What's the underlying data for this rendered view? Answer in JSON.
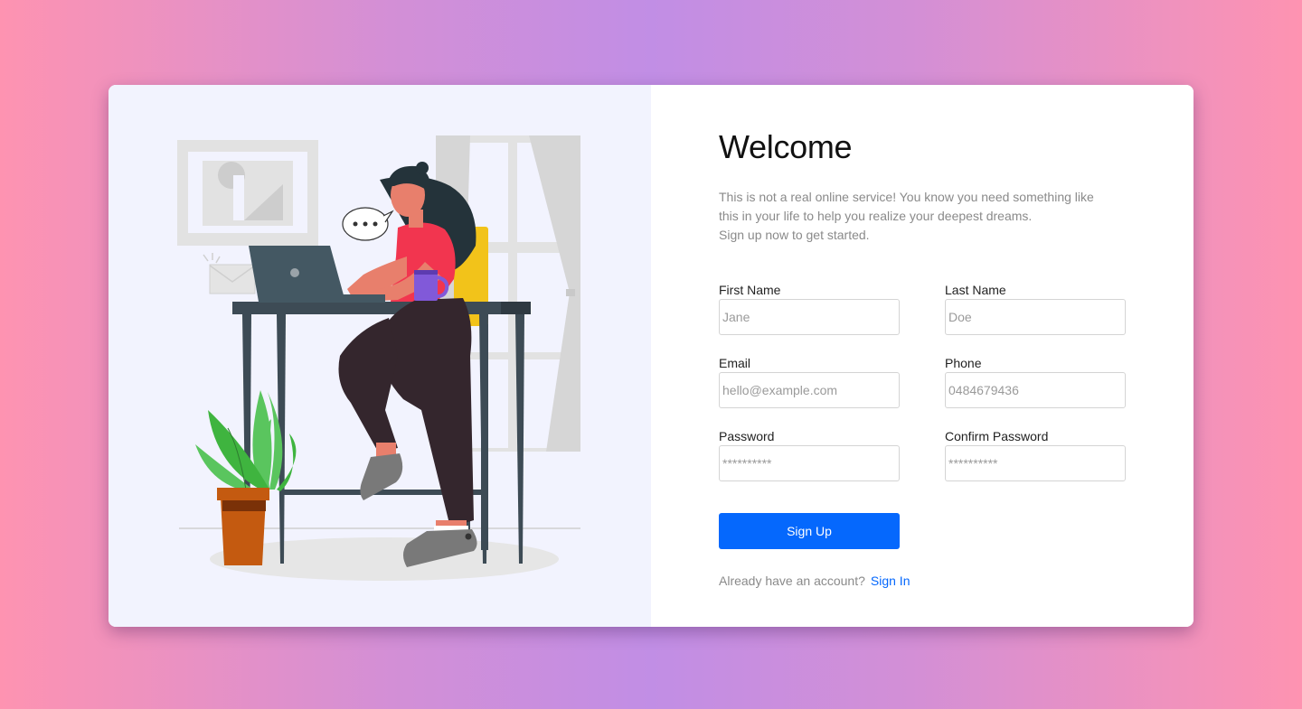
{
  "form": {
    "title": "Welcome",
    "description_lines": [
      "This is not a real online service! You know you need something like",
      "this in your life to help you realize your deepest dreams.",
      "Sign up now to get started."
    ],
    "fields": {
      "first_name": {
        "label": "First Name",
        "placeholder": "Jane",
        "value": ""
      },
      "last_name": {
        "label": "Last Name",
        "placeholder": "Doe",
        "value": ""
      },
      "email": {
        "label": "Email",
        "placeholder": "hello@example.com",
        "value": ""
      },
      "phone": {
        "label": "Phone",
        "placeholder": "0484679436",
        "value": ""
      },
      "password": {
        "label": "Password",
        "placeholder": "**********",
        "value": ""
      },
      "confirm_password": {
        "label": "Confirm Password",
        "placeholder": "**********",
        "value": ""
      }
    },
    "submit_label": "Sign Up",
    "signin_prompt": "Already have an account?",
    "signin_link": "Sign In"
  },
  "colors": {
    "accent": "#0568fd",
    "illustration_bg": "#f2f3fe",
    "background_gradient": [
      "#fe93b1",
      "#c18ee5"
    ]
  },
  "illustration": {
    "name": "woman-working-at-laptop-illustration"
  }
}
